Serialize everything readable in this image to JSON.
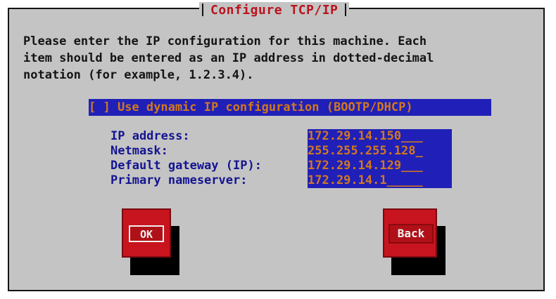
{
  "dialog": {
    "title": "Configure TCP/IP",
    "intro": "Please enter the IP configuration for this machine. Each\nitem should be entered as an IP address in dotted-decimal\nnotation (for example, 1.2.3.4).",
    "dhcp_checkbox": "[ ] Use dynamic IP configuration (BOOTP/DHCP)"
  },
  "fields": [
    {
      "label": "IP address:",
      "value": "172.29.14.150___"
    },
    {
      "label": "Netmask:",
      "value": "255.255.255.128_"
    },
    {
      "label": "Default gateway (IP):",
      "value": "172.29.14.129___"
    },
    {
      "label": "Primary nameserver:",
      "value": "172.29.14.1_____"
    }
  ],
  "buttons": {
    "ok_label": "OK",
    "back_label": "Back"
  },
  "colors": {
    "dialog_bg": "#c4c4c4",
    "field_bg": "#2020b8",
    "field_text": "#d2781e",
    "title_text": "#b8141e",
    "label_text": "#141491",
    "button_bg": "#c8141e",
    "button_text": "#f0f0f0"
  }
}
